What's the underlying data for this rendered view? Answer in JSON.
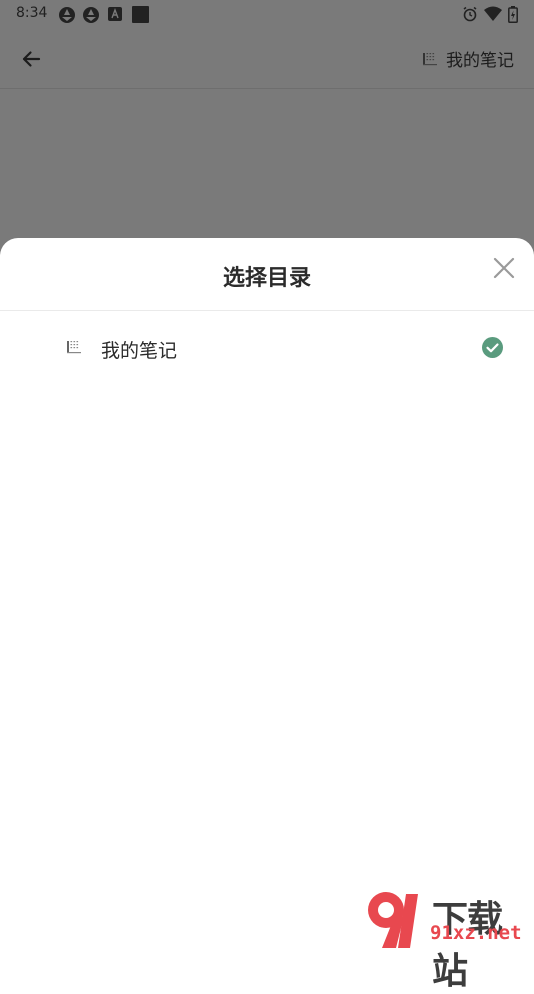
{
  "status_bar": {
    "time": "8:34"
  },
  "app_bar": {
    "folder_name": "我的笔记"
  },
  "sheet": {
    "title": "选择目录",
    "items": [
      {
        "label": "我的笔记",
        "selected": true
      }
    ]
  },
  "watermark": {
    "brand_cn": "下载站",
    "url": "91xz.net",
    "logo_text": "9"
  },
  "colors": {
    "accent_check": "#5a9b7e",
    "brand_red": "#e8484f",
    "scrim": "#7a7a7a"
  }
}
